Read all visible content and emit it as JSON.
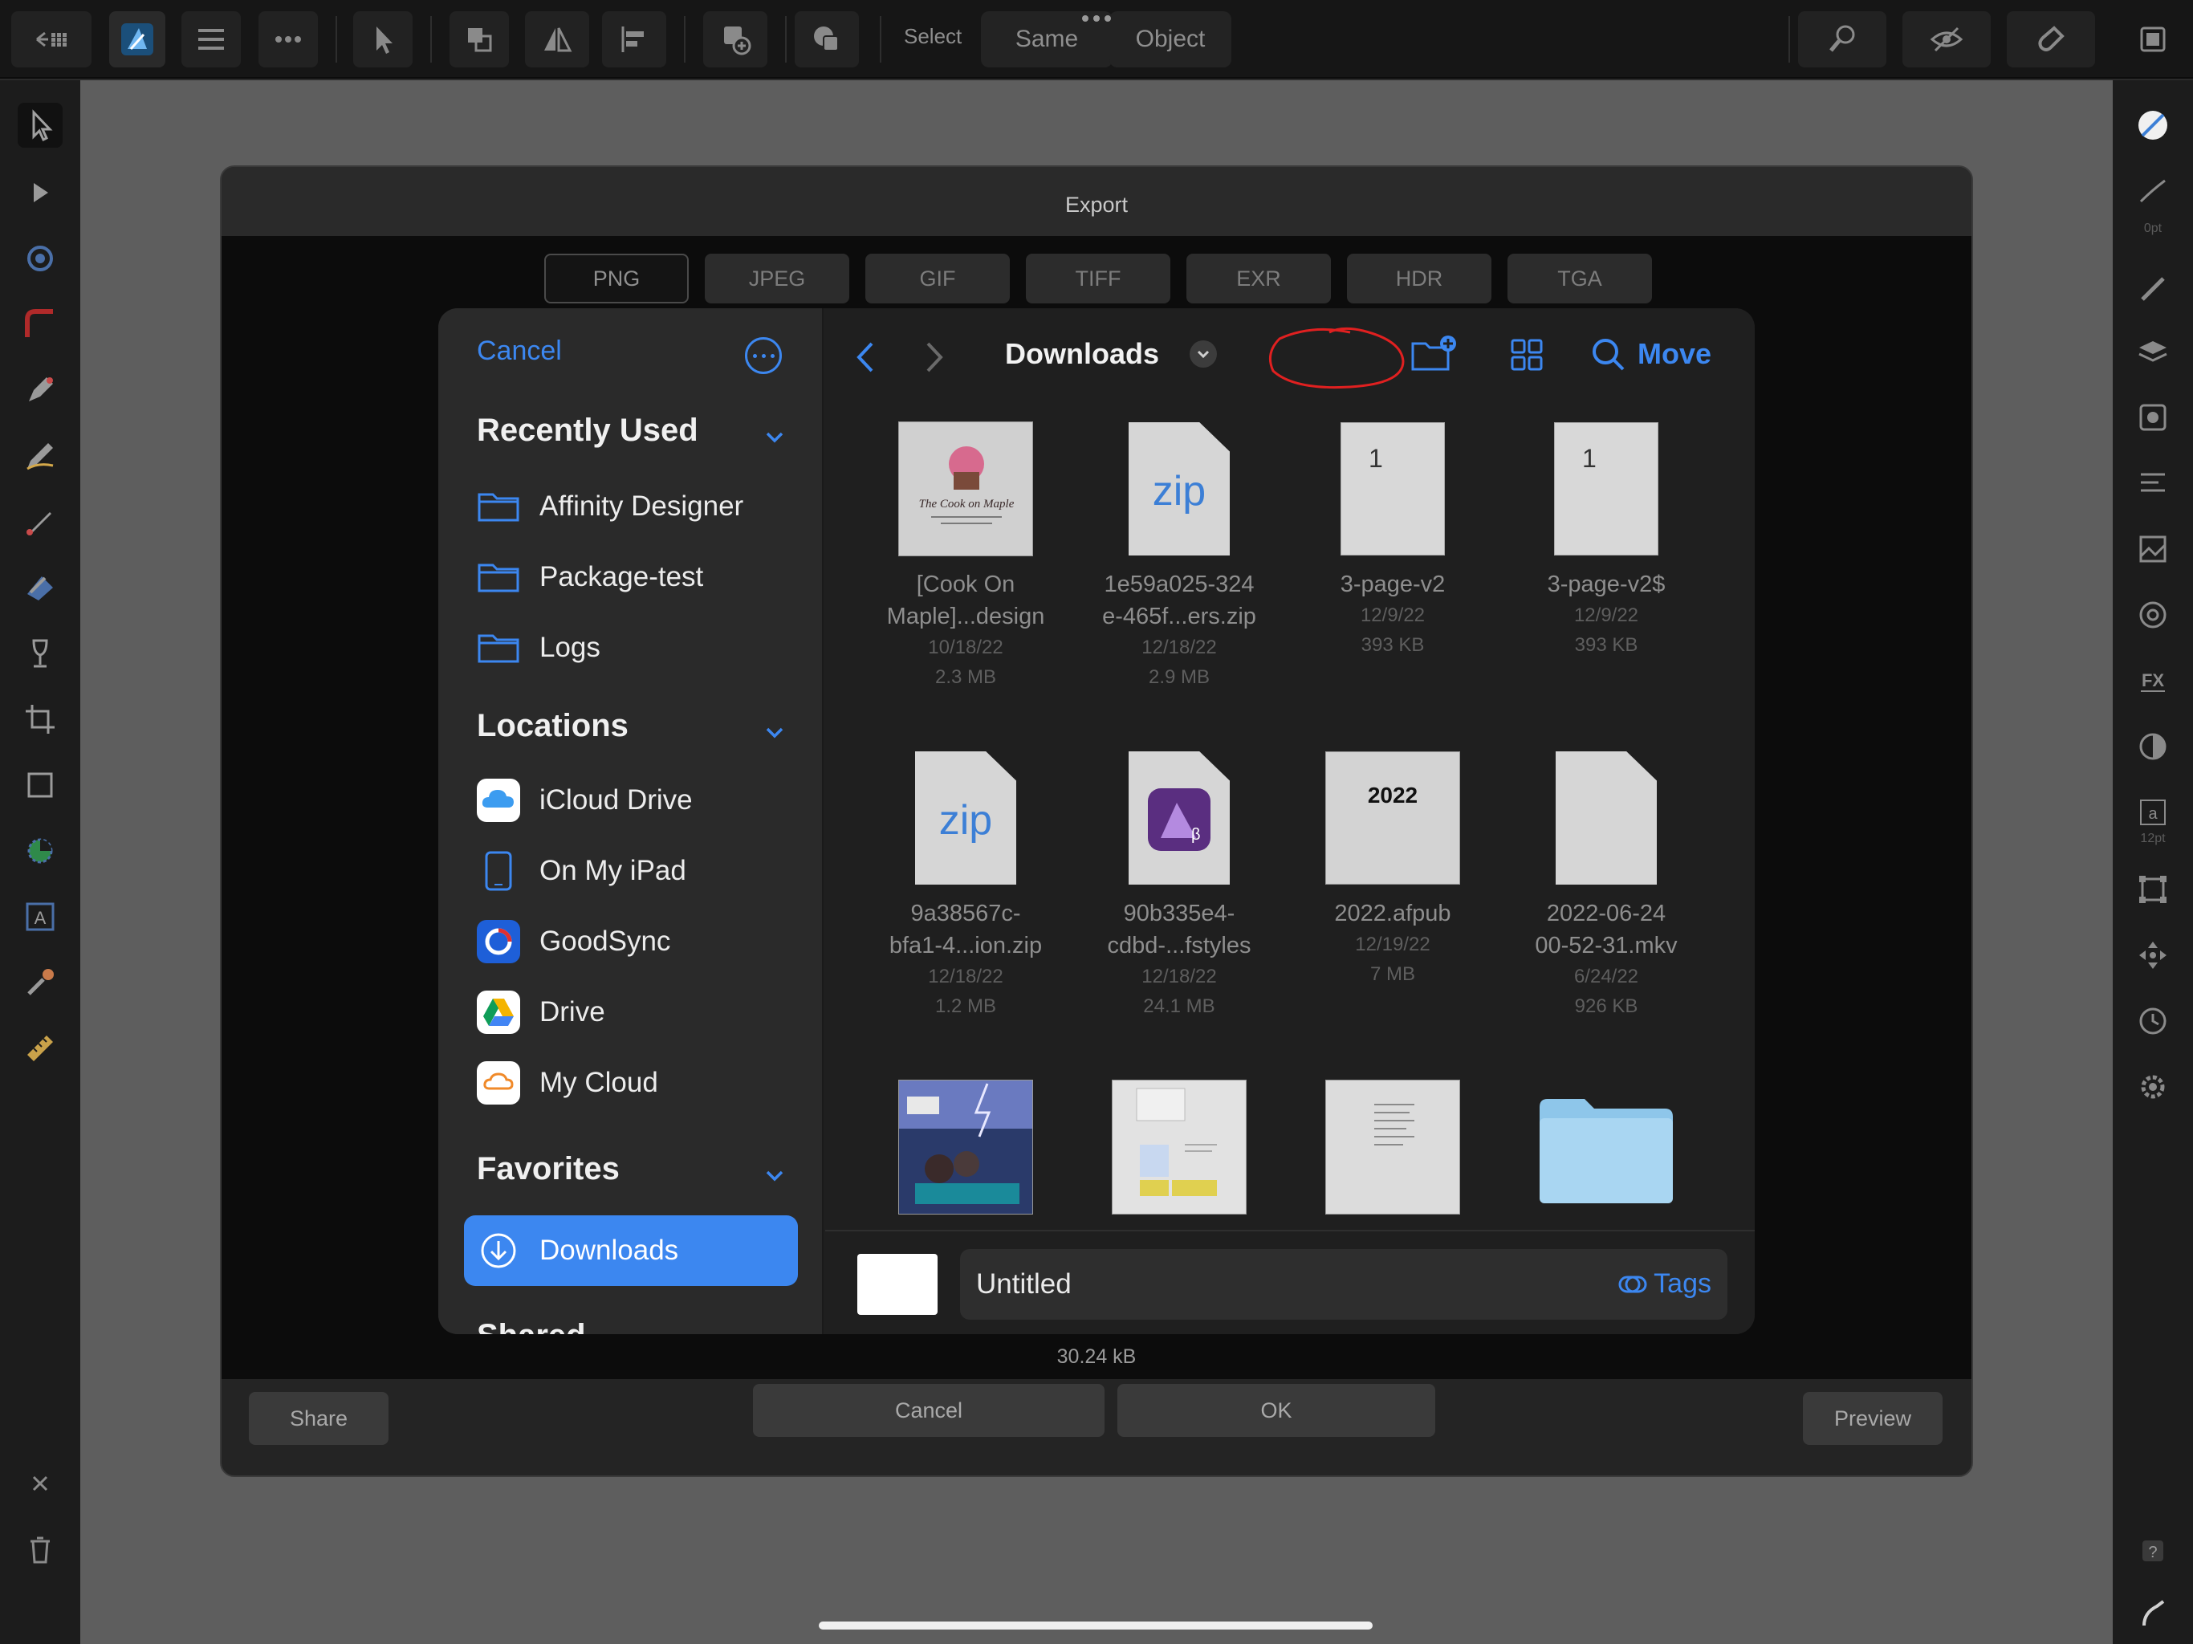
{
  "toolbar": {
    "select_label": "Select",
    "same_label": "Same",
    "object_label": "Object"
  },
  "right_panel": {
    "stroke_width_label": "0pt",
    "font_size_label": "12pt",
    "fx_label": "FX"
  },
  "export_dialog": {
    "title": "Export",
    "formats": [
      "PNG",
      "JPEG",
      "GIF",
      "TIFF",
      "EXR",
      "HDR",
      "TGA"
    ],
    "selected_format": "PNG",
    "file_size": "30.24 kB",
    "share_label": "Share",
    "cancel_label": "Cancel",
    "ok_label": "OK",
    "preview_label": "Preview"
  },
  "picker": {
    "cancel_label": "Cancel",
    "sections": {
      "recently_used": "Recently Used",
      "locations": "Locations",
      "favorites": "Favorites",
      "shared": "Shared"
    },
    "recently_used": [
      {
        "label": "Affinity Designer",
        "icon": "folder-icon"
      },
      {
        "label": "Package-test",
        "icon": "folder-icon"
      },
      {
        "label": "Logs",
        "icon": "folder-icon"
      }
    ],
    "locations": [
      {
        "label": "iCloud Drive",
        "icon": "icloud-icon"
      },
      {
        "label": "On My iPad",
        "icon": "ipad-icon"
      },
      {
        "label": "GoodSync",
        "icon": "goodsync-icon"
      },
      {
        "label": "Drive",
        "icon": "google-drive-icon"
      },
      {
        "label": "My Cloud",
        "icon": "my-cloud-icon"
      }
    ],
    "favorites": [
      {
        "label": "Downloads",
        "icon": "download-icon",
        "selected": true
      }
    ],
    "current_location": "Downloads",
    "move_label": "Move",
    "annotation_color": "#e02020",
    "accent_color": "#3c87f0",
    "files": [
      {
        "name_line1": "[Cook On",
        "name_line2": "Maple]...design",
        "date": "10/18/22",
        "size": "2.3 MB",
        "kind": "image",
        "thumb_text": "The Cook on Maple"
      },
      {
        "name_line1": "1e59a025-324",
        "name_line2": "e-465f...ers.zip",
        "date": "12/18/22",
        "size": "2.9 MB",
        "kind": "zip",
        "thumb_text": "zip"
      },
      {
        "name_line1": "3-page-v2",
        "name_line2": "",
        "date": "12/9/22",
        "size": "393 KB",
        "kind": "page",
        "thumb_text": "1"
      },
      {
        "name_line1": "3-page-v2$",
        "name_line2": "",
        "date": "12/9/22",
        "size": "393 KB",
        "kind": "page",
        "thumb_text": "1"
      },
      {
        "name_line1": "9a38567c-",
        "name_line2": "bfa1-4...ion.zip",
        "date": "12/18/22",
        "size": "1.2 MB",
        "kind": "zip",
        "thumb_text": "zip"
      },
      {
        "name_line1": "90b335e4-",
        "name_line2": "cdbd-...fstyles",
        "date": "12/18/22",
        "size": "24.1 MB",
        "kind": "afstyles",
        "thumb_text": "β"
      },
      {
        "name_line1": "2022.afpub",
        "name_line2": "",
        "date": "12/19/22",
        "size": "7 MB",
        "kind": "afpub",
        "thumb_text": "2022"
      },
      {
        "name_line1": "2022-06-24",
        "name_line2": "00-52-31.mkv",
        "date": "6/24/22",
        "size": "926 KB",
        "kind": "doc",
        "thumb_text": ""
      }
    ],
    "filename": "Untitled",
    "tags_label": "Tags"
  }
}
